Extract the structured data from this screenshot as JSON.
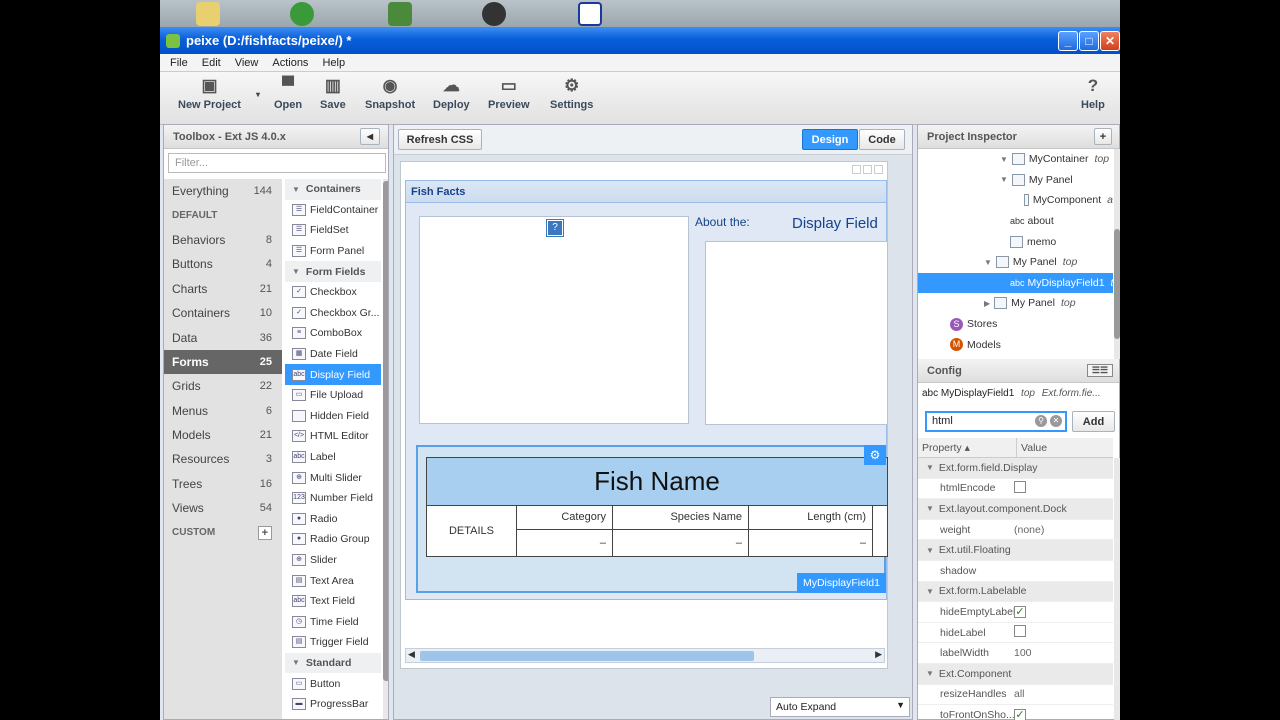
{
  "window": {
    "title": "peixe (D:/fishfacts/peixe/) *"
  },
  "menu": [
    "File",
    "Edit",
    "View",
    "Actions",
    "Help"
  ],
  "toolbar": {
    "new_project": "New Project",
    "open": "Open",
    "save": "Save",
    "snapshot": "Snapshot",
    "deploy": "Deploy",
    "preview": "Preview",
    "settings": "Settings",
    "help": "Help"
  },
  "toolbox": {
    "title": "Toolbox - Ext JS 4.0.x",
    "filter_placeholder": "Filter...",
    "categories": [
      {
        "label": "Everything",
        "count": "144"
      },
      {
        "label": "DEFAULT",
        "count": ""
      },
      {
        "label": "Behaviors",
        "count": "8"
      },
      {
        "label": "Buttons",
        "count": "4"
      },
      {
        "label": "Charts",
        "count": "21"
      },
      {
        "label": "Containers",
        "count": "10"
      },
      {
        "label": "Data",
        "count": "36"
      },
      {
        "label": "Forms",
        "count": "25"
      },
      {
        "label": "Grids",
        "count": "22"
      },
      {
        "label": "Menus",
        "count": "6"
      },
      {
        "label": "Models",
        "count": "21"
      },
      {
        "label": "Resources",
        "count": "3"
      },
      {
        "label": "Trees",
        "count": "16"
      },
      {
        "label": "Views",
        "count": "54"
      },
      {
        "label": "CUSTOM",
        "count": "+"
      }
    ],
    "components": [
      {
        "label": "Containers",
        "icon": ""
      },
      {
        "label": "FieldContainer",
        "icon": "☰"
      },
      {
        "label": "FieldSet",
        "icon": "☰"
      },
      {
        "label": "Form Panel",
        "icon": "☰"
      },
      {
        "label": "Form Fields",
        "icon": ""
      },
      {
        "label": "Checkbox",
        "icon": "✓"
      },
      {
        "label": "Checkbox Gr...",
        "icon": "✓"
      },
      {
        "label": "ComboBox",
        "icon": "≡"
      },
      {
        "label": "Date Field",
        "icon": "▦"
      },
      {
        "label": "Display Field",
        "icon": "abc"
      },
      {
        "label": "File Upload",
        "icon": "▭"
      },
      {
        "label": "Hidden Field",
        "icon": ""
      },
      {
        "label": "HTML Editor",
        "icon": "</>"
      },
      {
        "label": "Label",
        "icon": "abc"
      },
      {
        "label": "Multi Slider",
        "icon": "⊕"
      },
      {
        "label": "Number Field",
        "icon": "123"
      },
      {
        "label": "Radio",
        "icon": "●"
      },
      {
        "label": "Radio Group",
        "icon": "●"
      },
      {
        "label": "Slider",
        "icon": "⊕"
      },
      {
        "label": "Text Area",
        "icon": "▤"
      },
      {
        "label": "Text Field",
        "icon": "abc"
      },
      {
        "label": "Time Field",
        "icon": "◷"
      },
      {
        "label": "Trigger Field",
        "icon": "▤"
      },
      {
        "label": "Standard",
        "icon": ""
      },
      {
        "label": "Button",
        "icon": "▭"
      },
      {
        "label": "ProgressBar",
        "icon": "▬"
      }
    ]
  },
  "canvas": {
    "refresh_css": "Refresh CSS",
    "design_tab": "Design",
    "code_tab": "Code",
    "panel_title": "Fish Facts",
    "about_label": "About the:",
    "display_field_text": "Display Field",
    "fish_name": "Fish Name",
    "details_label": "DETAILS",
    "columns": [
      "Category",
      "Species Name",
      "Length (cm)"
    ],
    "cells": [
      "–",
      "–",
      "–"
    ],
    "selection_label": "MyDisplayField1",
    "auto_expand": "Auto Expand"
  },
  "inspector": {
    "title": "Project Inspector",
    "add_label": "+",
    "items": [
      {
        "label": "MyContainer",
        "suffix": "top",
        "indent": 82,
        "arrow": "▼"
      },
      {
        "label": "My Panel",
        "suffix": "",
        "indent": 82,
        "arrow": "▼"
      },
      {
        "label": "MyComponent",
        "suffix": "a",
        "indent": 106,
        "arrow": ""
      },
      {
        "label": "about",
        "suffix": "",
        "indent": 92,
        "arrow": "",
        "prefix": "abc"
      },
      {
        "label": "memo",
        "suffix": "",
        "indent": 92,
        "arrow": ""
      },
      {
        "label": "My Panel",
        "suffix": "top",
        "indent": 66,
        "arrow": "▼"
      },
      {
        "label": "MyDisplayField1",
        "suffix": "to",
        "indent": 92,
        "arrow": "",
        "prefix": "abc",
        "selected": true
      },
      {
        "label": "My Panel",
        "suffix": "top",
        "indent": 66,
        "arrow": "▶"
      },
      {
        "label": "Stores",
        "suffix": "",
        "indent": 32,
        "arrow": "",
        "badge": "S"
      },
      {
        "label": "Models",
        "suffix": "",
        "indent": 32,
        "arrow": "",
        "badge": "M"
      }
    ]
  },
  "config": {
    "title": "Config",
    "selected_name": "abc MyDisplayField1",
    "selected_suffix": "top",
    "selected_type": "Ext.form.fie...",
    "search_value": "html",
    "add_button": "Add",
    "col_property": "Property",
    "col_value": "Value",
    "rows": [
      {
        "group": "Ext.form.field.Display"
      },
      {
        "name": "htmlEncode",
        "value": "",
        "type": "check",
        "checked": false
      },
      {
        "group": "Ext.layout.component.Dock"
      },
      {
        "name": "weight",
        "value": "(none)"
      },
      {
        "group": "Ext.util.Floating"
      },
      {
        "name": "shadow",
        "value": ""
      },
      {
        "group": "Ext.form.Labelable"
      },
      {
        "name": "hideEmptyLabel",
        "value": "",
        "type": "check",
        "checked": true
      },
      {
        "name": "hideLabel",
        "value": "",
        "type": "check",
        "checked": false
      },
      {
        "name": "labelWidth",
        "value": "100"
      },
      {
        "group": "Ext.Component"
      },
      {
        "name": "resizeHandles",
        "value": "all"
      },
      {
        "name": "toFrontOnSho...",
        "value": "",
        "type": "check",
        "checked": true
      }
    ]
  }
}
